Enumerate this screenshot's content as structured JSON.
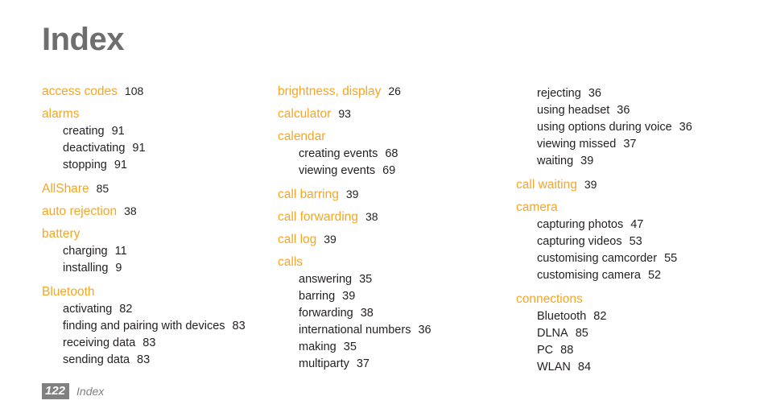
{
  "page": {
    "title": "Index",
    "accent_color": "#f5a623",
    "title_color": "#6e6e6e",
    "body_color": "#231f20",
    "footer_color": "#808080"
  },
  "footer": {
    "page_number": "122",
    "label": "Index"
  },
  "columns": [
    {
      "id": "column-1",
      "entries": [
        {
          "type": "main",
          "term": "access codes",
          "page": "108",
          "subentries": []
        },
        {
          "type": "main",
          "term": "alarms",
          "page": "",
          "subentries": [
            {
              "term": "creating",
              "page": "91"
            },
            {
              "term": "deactivating",
              "page": "91"
            },
            {
              "term": "stopping",
              "page": "91"
            }
          ]
        },
        {
          "type": "main",
          "term": "AllShare",
          "page": "85",
          "subentries": []
        },
        {
          "type": "main",
          "term": "auto rejection",
          "page": "38",
          "subentries": []
        },
        {
          "type": "main",
          "term": "battery",
          "page": "",
          "subentries": [
            {
              "term": "charging",
              "page": "11"
            },
            {
              "term": "installing",
              "page": "9"
            }
          ]
        },
        {
          "type": "main",
          "term": "Bluetooth",
          "page": "",
          "subentries": [
            {
              "term": "activating",
              "page": "82"
            },
            {
              "term": "finding and pairing with devices",
              "page": "83"
            },
            {
              "term": "receiving data",
              "page": "83"
            },
            {
              "term": "sending data",
              "page": "83"
            }
          ]
        }
      ]
    },
    {
      "id": "column-2",
      "entries": [
        {
          "type": "main",
          "term": "brightness, display",
          "page": "26",
          "subentries": []
        },
        {
          "type": "main",
          "term": "calculator",
          "page": "93",
          "subentries": []
        },
        {
          "type": "main",
          "term": "calendar",
          "page": "",
          "subentries": [
            {
              "term": "creating events",
              "page": "68"
            },
            {
              "term": "viewing events",
              "page": "69"
            }
          ]
        },
        {
          "type": "main",
          "term": "call barring",
          "page": "39",
          "subentries": []
        },
        {
          "type": "main",
          "term": "call forwarding",
          "page": "38",
          "subentries": []
        },
        {
          "type": "main",
          "term": "call log",
          "page": "39",
          "subentries": []
        },
        {
          "type": "main",
          "term": "calls",
          "page": "",
          "subentries": [
            {
              "term": "answering",
              "page": "35"
            },
            {
              "term": "barring",
              "page": "39"
            },
            {
              "term": "forwarding",
              "page": "38"
            },
            {
              "term": "international numbers",
              "page": "36"
            },
            {
              "term": "making",
              "page": "35"
            },
            {
              "term": "multiparty",
              "page": "37"
            }
          ]
        }
      ]
    },
    {
      "id": "column-3",
      "entries": [
        {
          "type": "continuation",
          "term": "",
          "page": "",
          "subentries": [
            {
              "term": "rejecting",
              "page": "36"
            },
            {
              "term": "using headset",
              "page": "36"
            },
            {
              "term": "using options during voice",
              "page": "36"
            },
            {
              "term": "viewing missed",
              "page": "37"
            },
            {
              "term": "waiting",
              "page": "39"
            }
          ]
        },
        {
          "type": "main",
          "term": "call waiting",
          "page": "39",
          "subentries": []
        },
        {
          "type": "main",
          "term": "camera",
          "page": "",
          "subentries": [
            {
              "term": "capturing photos",
              "page": "47"
            },
            {
              "term": "capturing videos",
              "page": "53"
            },
            {
              "term": "customising camcorder",
              "page": "55"
            },
            {
              "term": "customising camera",
              "page": "52"
            }
          ]
        },
        {
          "type": "main",
          "term": "connections",
          "page": "",
          "subentries": [
            {
              "term": "Bluetooth",
              "page": "82"
            },
            {
              "term": "DLNA",
              "page": "85"
            },
            {
              "term": "PC",
              "page": "88"
            },
            {
              "term": "WLAN",
              "page": "84"
            }
          ]
        }
      ]
    }
  ]
}
